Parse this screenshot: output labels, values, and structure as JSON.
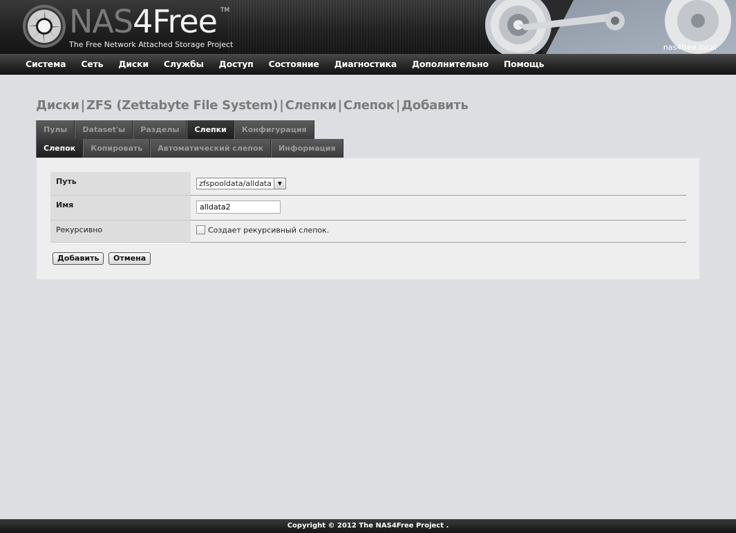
{
  "header": {
    "brand_nas": "NAS",
    "brand_free": "4Free",
    "trademark": "TM",
    "tagline": "The Free Network Attached Storage Project",
    "hostname": "nas4free.local",
    "logo_icon": "nas4free-disc-logo",
    "art": "hard-drive-platter-image"
  },
  "menu": [
    {
      "label": "Система"
    },
    {
      "label": "Сеть"
    },
    {
      "label": "Диски"
    },
    {
      "label": "Службы"
    },
    {
      "label": "Доступ"
    },
    {
      "label": "Состояние"
    },
    {
      "label": "Диагностика"
    },
    {
      "label": "Дополнительно"
    },
    {
      "label": "Помощь"
    }
  ],
  "breadcrumb": [
    {
      "label": "Диски"
    },
    {
      "label": "ZFS (Zettabyte File System)"
    },
    {
      "label": "Слепки"
    },
    {
      "label": "Слепок"
    },
    {
      "label": "Добавить"
    }
  ],
  "tabs_primary": [
    {
      "label": "Пулы",
      "active": false
    },
    {
      "label": "Dataset'ы",
      "active": false
    },
    {
      "label": "Разделы",
      "active": false
    },
    {
      "label": "Слепки",
      "active": true
    },
    {
      "label": "Конфигурация",
      "active": false
    }
  ],
  "tabs_secondary": [
    {
      "label": "Слепок",
      "active": true
    },
    {
      "label": "Копировать",
      "active": false
    },
    {
      "label": "Автоматический слепок",
      "active": false
    },
    {
      "label": "Информация",
      "active": false
    }
  ],
  "form": {
    "path": {
      "label": "Путь",
      "value": "zfspooldata/alldata"
    },
    "name": {
      "label": "Имя",
      "value": "alldata2"
    },
    "recursive": {
      "label": "Рекурсивно",
      "checkbox_label": "Создает рекурсивный слепок.",
      "checked": false
    }
  },
  "buttons": {
    "add": "Добавить",
    "cancel": "Отмена"
  },
  "footer": {
    "copyright": "Copyright © 2012 The NAS4Free Project ."
  },
  "colors": {
    "page_bg": "#dcdee2",
    "menu_bg": "#2b2b2b",
    "title": "#7b7b7b",
    "panel_bg": "#eeeeee"
  }
}
